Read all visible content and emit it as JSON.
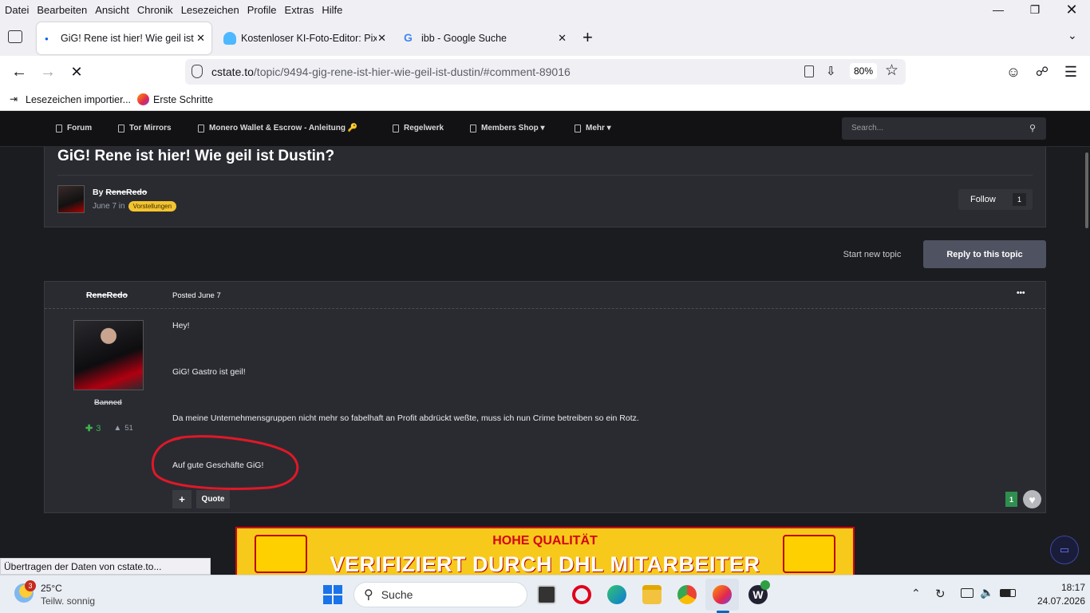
{
  "menu": [
    "Datei",
    "Bearbeiten",
    "Ansicht",
    "Chronik",
    "Lesezeichen",
    "Profile",
    "Extras",
    "Hilfe"
  ],
  "tabs": [
    {
      "title": "GiG! Rene ist hier! Wie geil ist D"
    },
    {
      "title": "Kostenloser KI-Foto-Editor: Pixlr"
    },
    {
      "title": "ibb - Google Suche"
    }
  ],
  "url": {
    "host": "cstate.to",
    "path": "/topic/9494-gig-rene-ist-hier-wie-geil-ist-dustin/#comment-89016",
    "zoom": "80%"
  },
  "bookmarks": [
    "Lesezeichen importier...",
    "Erste Schritte"
  ],
  "sitenav": {
    "items": [
      "Forum",
      "Tor Mirrors",
      "Monero Wallet & Escrow - Anleitung 🔑",
      "Regelwerk",
      "Members Shop ▾",
      "Mehr ▾"
    ],
    "search_placeholder": "Search..."
  },
  "topic": {
    "title": "GiG! Rene ist hier! Wie geil ist Dustin?",
    "by": "By",
    "author": "ReneRedo",
    "date": "June 7 in",
    "category": "Vorstellungen",
    "follow": "Follow",
    "follow_count": "1",
    "start_new": "Start new topic",
    "reply": "Reply to this topic"
  },
  "post": {
    "author": "ReneRedo",
    "posted": "Posted June 7",
    "role": "Banned",
    "reputation": "3",
    "posts": "51",
    "lines": [
      "Hey!",
      "GiG! Gastro ist geil!",
      "Da meine Unternehmensgruppen nicht mehr so fabelhaft an Profit abdrückt weßte, muss ich nun Crime betreiben so ein Rotz.",
      "Auf gute Geschäfte GiG!"
    ],
    "quote": "Quote",
    "plus": "+",
    "reaction_count": "1",
    "more": "•••"
  },
  "ad": {
    "line1": "HOHE QUALITÄT",
    "line2": "VERIFIZIERT DURCH DHL MITARBEITER"
  },
  "status": "Übertragen der Daten von cstate.to...",
  "taskbar": {
    "weather_temp": "25°C",
    "weather_desc": "Teilw. sonnig",
    "weather_badge": "3",
    "search": "Suche",
    "time": "18:17",
    "date": "24.07.2026"
  },
  "colors": {
    "accent": "#d40511",
    "badge": "#f4c430",
    "rep": "#3fb34f"
  }
}
